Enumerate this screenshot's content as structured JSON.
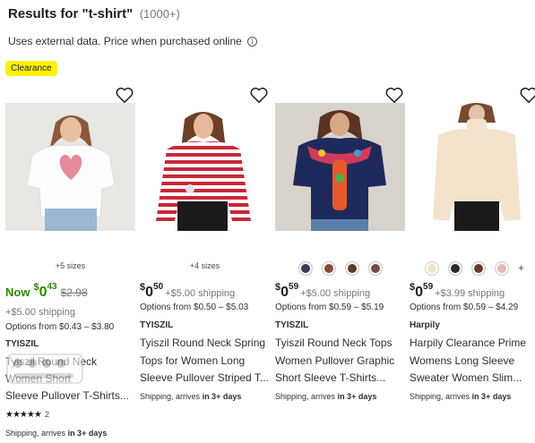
{
  "header": {
    "title": "Results for \"t-shirt\"",
    "count": "(1000+)",
    "note": "Uses external data. Price when purchased online"
  },
  "badge": "Clearance",
  "products": [
    {
      "meta": "+5 sizes",
      "price_prefix": "Now",
      "price_dollar": "$",
      "price_whole": "0",
      "price_cents": "43",
      "was_price": "$2.98",
      "shipping_price": "+$5.00 shipping",
      "options": "Options from $0.43 – $3.80",
      "brand": "TYISZIL",
      "title_lines": [
        "Tyiszil Round Neck",
        "Women Short",
        "Sleeve Pullover T-Shirts..."
      ],
      "rating_stars": "★★★★★",
      "rating_count": "2",
      "shipping_text": "Shipping, arrives",
      "shipping_eta": "in 3+ days"
    },
    {
      "meta": "+4 sizes",
      "price_dollar": "$",
      "price_whole": "0",
      "price_cents": "50",
      "shipping_price": "+$5.00 shipping",
      "options": "Options from $0.50 – $5.03",
      "brand": "TYISZIL",
      "title_lines": [
        "Tyiszil Round Neck Spring",
        "Tops for Women Long",
        "Sleeve Pullover Striped T..."
      ],
      "shipping_text": "Shipping, arrives",
      "shipping_eta": "in 3+ days"
    },
    {
      "price_dollar": "$",
      "price_whole": "0",
      "price_cents": "59",
      "shipping_price": "+$5.00 shipping",
      "options": "Options from $0.59 – $5.19",
      "brand": "TYISZIL",
      "title_lines": [
        "Tyiszil Round Neck Tops",
        "Women Pullover Graphic",
        "Short Sleeve T-Shirts..."
      ],
      "shipping_text": "Shipping, arrives",
      "shipping_eta": "in 3+ days"
    },
    {
      "price_dollar": "$",
      "price_whole": "0",
      "price_cents": "59",
      "shipping_price": "+$3.99 shipping",
      "options": "Options from $0.59 – $4.29",
      "brand": "Harpily",
      "title_lines": [
        "Harpily Clearance Prime",
        "Womens Long Sleeve",
        "Sweater Women Slim..."
      ],
      "shipping_text": "Shipping, arrives",
      "shipping_eta": "in 3+ days",
      "more_swatches": "+"
    }
  ],
  "icons": {
    "favorite": "heart-outline-icon",
    "info": "info-icon",
    "rating": "star-icon"
  },
  "colors": {
    "price_green": "#2a8703",
    "badge_yellow": "#fff200",
    "muted_text": "#74767c"
  }
}
